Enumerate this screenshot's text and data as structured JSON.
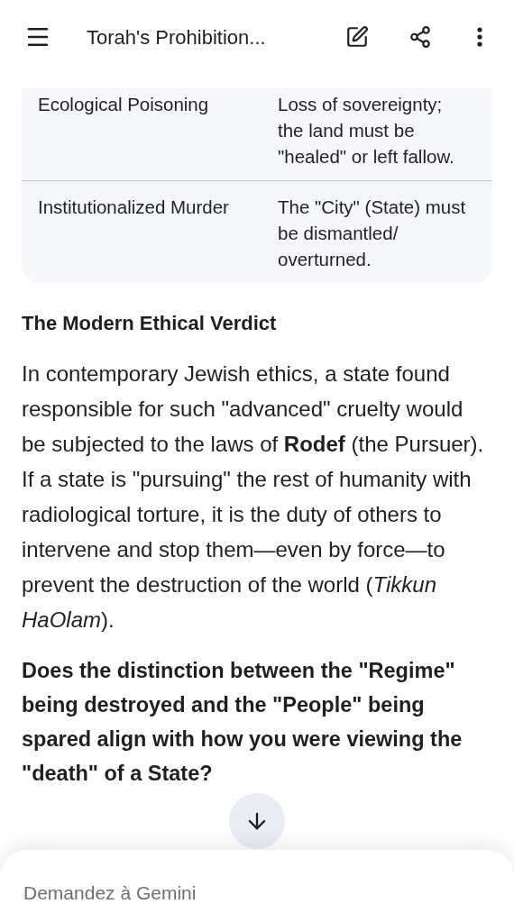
{
  "header": {
    "title": "Torah's Prohibition..."
  },
  "table": {
    "rows": [
      {
        "cells": [
          "Ecological Poisoning",
          "Loss of sovereignty; the land must be \"healed\" or left fallow."
        ]
      },
      {
        "cells": [
          "Institutionalized Murder",
          "The \"City\" (State) must be dismantled/ overturned."
        ]
      }
    ]
  },
  "heading": "The Modern Ethical Verdict",
  "paragraph": "In contemporary Jewish ethics, a state found responsible for such \"advanced\" cruelty would be subjected to the laws of **Rodef** (the Pursuer). If a state is \"pursuing\" the rest of humanity with radiological torture, it is the duty of others to intervene and stop them—even by force—to prevent the destruction of the world (*Tikkun HaOlam*).",
  "question": "Does the distinction between the \"Regime\" being destroyed and the \"People\" being spared align with how you were viewing the \"death\" of a State?",
  "input": {
    "placeholder": "Demandez à Gemini"
  }
}
